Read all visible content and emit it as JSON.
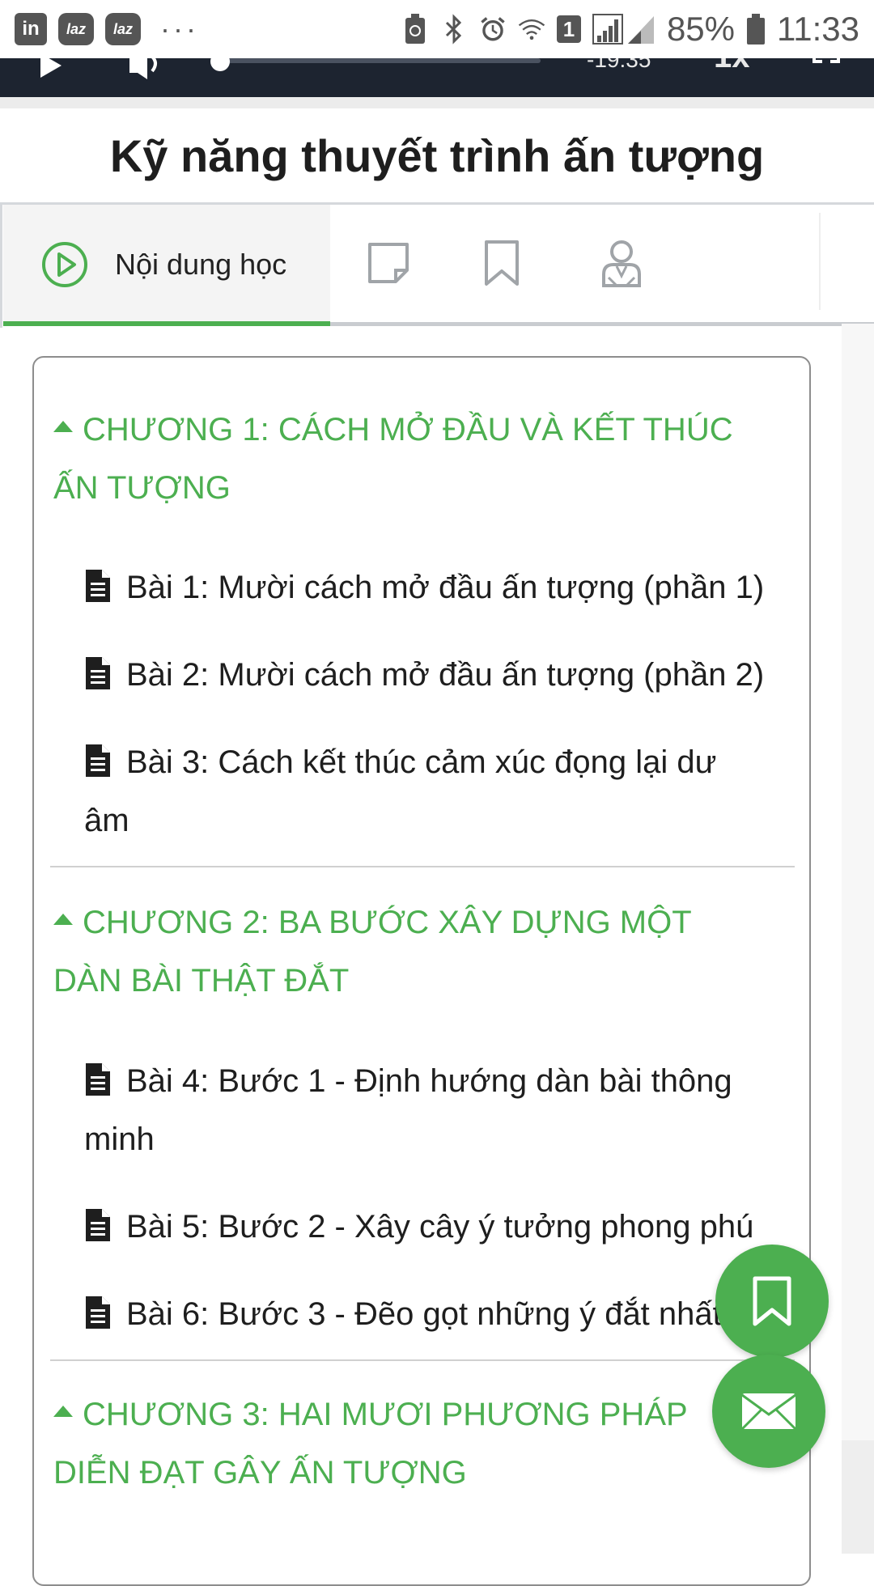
{
  "status_bar": {
    "app_icons": [
      "in",
      "laz",
      "laz"
    ],
    "more": "···",
    "sim_slot": "1",
    "battery": "85%",
    "time": "11:33"
  },
  "video": {
    "time_remaining": "-19:35",
    "speed": "1x"
  },
  "course": {
    "title": "Kỹ năng thuyết trình ấn tượng"
  },
  "tabs": {
    "active_label": "Nội dung học",
    "icons": [
      "play-circle-icon",
      "note-icon",
      "bookmark-icon",
      "instructor-icon"
    ]
  },
  "chapters": [
    {
      "title": "CHƯƠNG 1: CÁCH MỞ ĐẦU VÀ KẾT THÚC ẤN TƯỢNG",
      "lessons": [
        "Bài 1: Mười cách mở đầu ấn tượng (phần 1)",
        "Bài 2: Mười cách mở đầu ấn tượng (phần 2)",
        "Bài 3: Cách kết thúc cảm xúc đọng lại dư âm"
      ]
    },
    {
      "title": "CHƯƠNG 2: BA BƯỚC XÂY DỰNG MỘT DÀN BÀI THẬT ĐẮT",
      "lessons": [
        "Bài 4: Bước 1 - Định hướng dàn bài thông minh",
        "Bài 5: Bước 2 - Xây cây ý tưởng phong phú",
        "Bài 6: Bước 3 - Đẽo gọt những ý đắt nhất"
      ]
    },
    {
      "title": "CHƯƠNG 3: HAI MƯƠI PHƯƠNG PHÁP DIỄN ĐẠT GÂY ẤN TƯỢNG",
      "lessons": []
    }
  ],
  "colors": {
    "accent": "#4caf50",
    "video_bar": "#1d2430"
  }
}
